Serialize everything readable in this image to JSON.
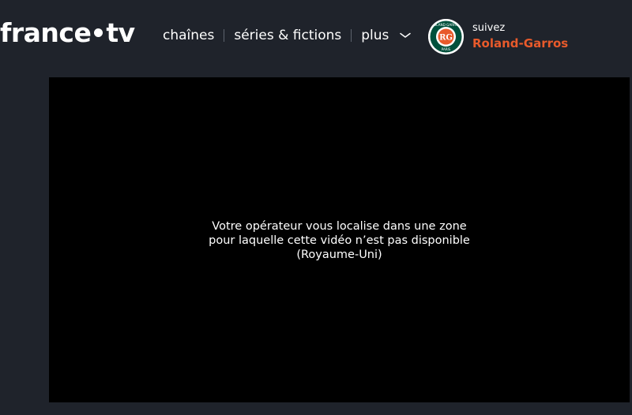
{
  "header": {
    "logo": {
      "left": "france",
      "right": "tv"
    },
    "nav": {
      "items": [
        {
          "label": "chaînes"
        },
        {
          "label": "séries & fictions"
        },
        {
          "label": "plus"
        }
      ]
    },
    "promo": {
      "follow_label": "suivez",
      "event_name": "Roland-Garros",
      "logo_text_top": "ROLAND GARROS",
      "logo_text_bottom": "PARIS",
      "logo_monogram": "RG",
      "accent_color": "#e85a2b",
      "logo_green": "#00503c"
    }
  },
  "player": {
    "message_lines": [
      "Votre opérateur vous localise dans une zone",
      "pour laquelle cette vidéo n’est pas disponible",
      "(Royaume-Uni)"
    ]
  },
  "colors": {
    "background": "#1f232b",
    "player_background": "#000000",
    "text": "#ffffff"
  }
}
